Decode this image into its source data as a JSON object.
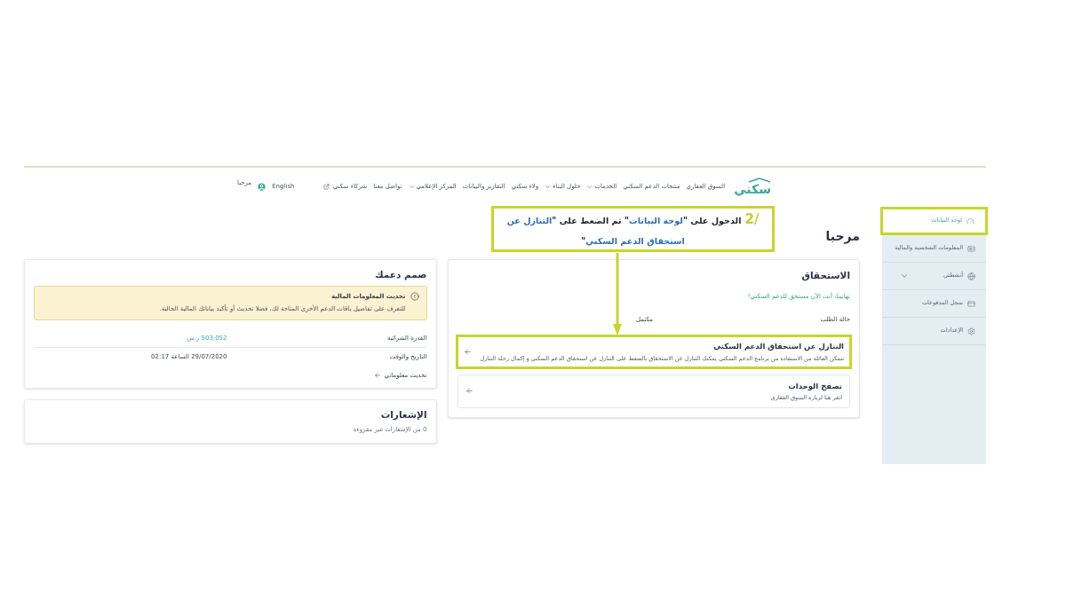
{
  "header": {
    "logo": "سكني",
    "nav": [
      {
        "label": "السوق العقاري",
        "kind": "link"
      },
      {
        "label": "منتجات الدعم السكني",
        "kind": "link"
      },
      {
        "label": "الخدمات",
        "kind": "menu"
      },
      {
        "label": "حلول البناء",
        "kind": "menu"
      },
      {
        "label": "ولاء سكني",
        "kind": "link"
      },
      {
        "label": "التقارير والبيانات",
        "kind": "link"
      },
      {
        "label": "المركز الإعلامي",
        "kind": "menu"
      },
      {
        "label": "تواصل معنا",
        "kind": "link"
      },
      {
        "label": "شركاء سكني",
        "kind": "external"
      }
    ],
    "language": "English",
    "greeting": "مرحبا"
  },
  "sidebar": {
    "items": [
      {
        "label": "لوحة البيانات",
        "selected": true,
        "highlighted": true
      },
      {
        "label": "المعلومات الشخصية والمالية",
        "selected": false,
        "highlighted": false
      },
      {
        "label": "أنشطتي",
        "selected": false,
        "highlighted": false,
        "expanded": false
      },
      {
        "label": "سجل المدفوعات",
        "selected": false,
        "highlighted": false
      },
      {
        "label": "الإعدادات",
        "selected": false,
        "highlighted": false
      }
    ]
  },
  "welcome": "مرحبا",
  "callout": {
    "step": "2/",
    "segments": [
      {
        "text": "الدخول على \"",
        "emphasis": false
      },
      {
        "text": "لوحة البيانات",
        "emphasis": true
      },
      {
        "text": "\" ثم الضغط على \"",
        "emphasis": false
      },
      {
        "text": "التنازل عن استحقاق الدعم السكني",
        "emphasis": true
      },
      {
        "text": "\"",
        "emphasis": false
      }
    ]
  },
  "eligibility": {
    "title": "الاستحقاق",
    "message": "تهانينا، أنت الآن مستحق للدعم السكني!",
    "status_label": "حالة الطلب",
    "status_value": "مكتمل",
    "actions": [
      {
        "title": "التنازل عن استحقاق الدعم السكني",
        "description": "تتمكن العائلة من الاستفادة من برنامج الدعم السكني يمكنك التنازل عن الاستحقاق بالضغط على التنازل عن استحقاق الدعم السكني و إكمال رحلة التنازل",
        "highlighted": true
      },
      {
        "title": "تصفح الوحدات",
        "description": "انقر هنا لزيارة السوق العقاري",
        "highlighted": false
      }
    ]
  },
  "support_design": {
    "title": "صمم دعمك",
    "alert": {
      "title": "تحديث المعلومات المالية",
      "text": "للتعرف على تفاصيل باقات الدعم الأخرى المتاحة لك، فضلا تحديث أو تأكيد بياناتك المالية الحالية."
    },
    "rows": [
      {
        "label": "القدرة الشرائية",
        "value": "503,052 ر.س",
        "kind": "amount"
      },
      {
        "label": "التاريخ والوقت",
        "value": "29/07/2020 الساعة 02:17",
        "kind": "plain"
      }
    ],
    "link": "تحديث معلوماتي"
  },
  "notifications": {
    "title": "الإشعارات",
    "summary": "0 من الإشعارات غير مقروءة"
  }
}
